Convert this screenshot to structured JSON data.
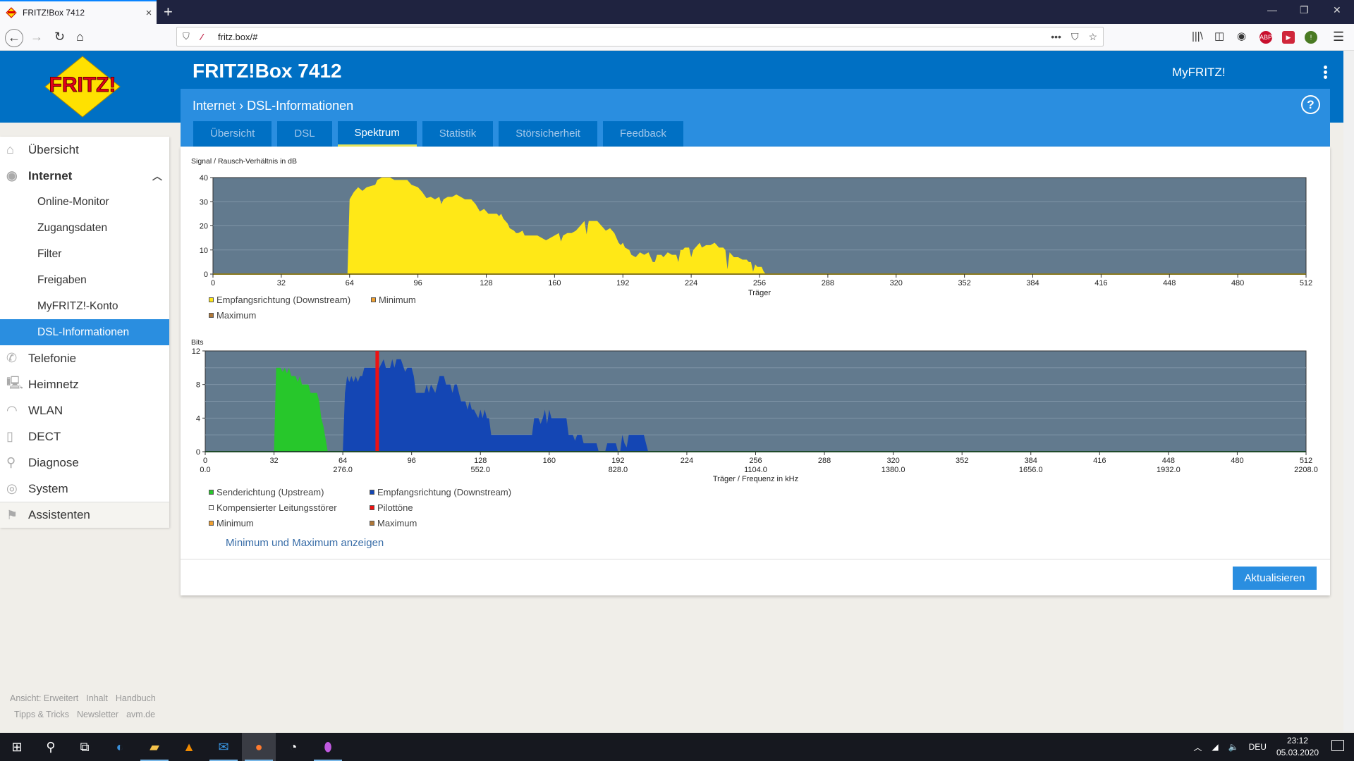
{
  "browser": {
    "tab_title": "FRITZ!Box 7412",
    "url": "fritz.box/#",
    "new_tab_label": "+",
    "close_tab_label": "×"
  },
  "header": {
    "title": "FRITZ!Box 7412",
    "myfritz": "MyFRITZ!",
    "breadcrumb_parent": "Internet",
    "breadcrumb_sep": ">",
    "breadcrumb_current": "DSL-Informationen",
    "help_label": "?",
    "logo_text": "FRITZ!"
  },
  "tabs": [
    {
      "label": "Übersicht",
      "active": false
    },
    {
      "label": "DSL",
      "active": false
    },
    {
      "label": "Spektrum",
      "active": true
    },
    {
      "label": "Statistik",
      "active": false
    },
    {
      "label": "Störsicherheit",
      "active": false
    },
    {
      "label": "Feedback",
      "active": false
    }
  ],
  "sidebar": {
    "items": [
      {
        "label": "Übersicht",
        "icon": "home-icon",
        "glyph": "⌂"
      },
      {
        "label": "Internet",
        "icon": "globe-icon",
        "glyph": "◉",
        "expanded": true
      },
      {
        "label": "Online-Monitor",
        "sub": true
      },
      {
        "label": "Zugangsdaten",
        "sub": true
      },
      {
        "label": "Filter",
        "sub": true
      },
      {
        "label": "Freigaben",
        "sub": true
      },
      {
        "label": "MyFRITZ!-Konto",
        "sub": true
      },
      {
        "label": "DSL-Informationen",
        "sub": true,
        "active": true
      },
      {
        "label": "Telefonie",
        "icon": "phone-icon",
        "glyph": "✆"
      },
      {
        "label": "Heimnetz",
        "icon": "network-icon",
        "glyph": "🖳"
      },
      {
        "label": "WLAN",
        "icon": "wifi-icon",
        "glyph": "◠"
      },
      {
        "label": "DECT",
        "icon": "dect-phone-icon",
        "glyph": "▯"
      },
      {
        "label": "Diagnose",
        "icon": "diagnose-icon",
        "glyph": "⚲"
      },
      {
        "label": "System",
        "icon": "system-icon",
        "glyph": "◎"
      },
      {
        "label": "Assistenten",
        "icon": "assistant-icon",
        "glyph": "⚑"
      }
    ],
    "footer_row1": [
      "Ansicht: Erweitert",
      "Inhalt",
      "Handbuch"
    ],
    "footer_row2": [
      "Tipps & Tricks",
      "Newsletter",
      "avm.de"
    ]
  },
  "content": {
    "show_minmax_link": "Minimum und Maximum anzeigen",
    "refresh_button": "Aktualisieren"
  },
  "colors": {
    "brand_blue": "#0070c4",
    "accent_blue": "#2a8ee0",
    "plot_bg": "#627a8e",
    "snr_yellow": "#ffe817",
    "upstream_green": "#27c72b",
    "downstream_blue": "#1446b4",
    "pilot_red": "#ee1111",
    "minimum_orange": "#f0a030",
    "maximum_brown": "#b07838"
  },
  "chart_data": [
    {
      "type": "area",
      "title": "Signal / Rausch-Verhältnis in dB",
      "xlabel": "Träger",
      "ylabel": "Signal / Rausch-Verhältnis in dB",
      "xlim": [
        0,
        512
      ],
      "ylim": [
        0,
        40
      ],
      "x_ticks": [
        0,
        32,
        64,
        96,
        128,
        160,
        192,
        224,
        256,
        288,
        320,
        352,
        384,
        416,
        448,
        480,
        512
      ],
      "y_ticks": [
        0,
        10,
        20,
        30,
        40
      ],
      "grid": true,
      "legend": [
        {
          "label": "Empfangsrichtung (Downstream)",
          "color": "#ffe817"
        },
        {
          "label": "Minimum",
          "color": "#f0a030"
        },
        {
          "label": "Maximum",
          "color": "#b07838"
        }
      ],
      "series": [
        {
          "name": "Empfangsrichtung (Downstream)",
          "color": "#ffe817",
          "points": [
            [
              63,
              0
            ],
            [
              64,
              31
            ],
            [
              66,
              34
            ],
            [
              68,
              36
            ],
            [
              70,
              34.5
            ],
            [
              72,
              36
            ],
            [
              74,
              36.5
            ],
            [
              76,
              37
            ],
            [
              77,
              39
            ],
            [
              79,
              40
            ],
            [
              83,
              40
            ],
            [
              85,
              39
            ],
            [
              91,
              39
            ],
            [
              93,
              37
            ],
            [
              96,
              36
            ],
            [
              98,
              34
            ],
            [
              100,
              31.5
            ],
            [
              102,
              32
            ],
            [
              104,
              31
            ],
            [
              106,
              32
            ],
            [
              107,
              29
            ],
            [
              108,
              31
            ],
            [
              110,
              32
            ],
            [
              112,
              32
            ],
            [
              114,
              33
            ],
            [
              116,
              32
            ],
            [
              118,
              31
            ],
            [
              121,
              31
            ],
            [
              123,
              29
            ],
            [
              125,
              26
            ],
            [
              127,
              27
            ],
            [
              129,
              25
            ],
            [
              133,
              25
            ],
            [
              134,
              24
            ],
            [
              135,
              25
            ],
            [
              136,
              23
            ],
            [
              138,
              21
            ],
            [
              139,
              19
            ],
            [
              141,
              18
            ],
            [
              142,
              17
            ],
            [
              143,
              17
            ],
            [
              145,
              18
            ],
            [
              146,
              16
            ],
            [
              152,
              16
            ],
            [
              154,
              15
            ],
            [
              156,
              14
            ],
            [
              158,
              15
            ],
            [
              160,
              16
            ],
            [
              162,
              17
            ],
            [
              163,
              13.5
            ],
            [
              164,
              16
            ],
            [
              166,
              17
            ],
            [
              168,
              17
            ],
            [
              170,
              18
            ],
            [
              172,
              20
            ],
            [
              174,
              22
            ],
            [
              175,
              16.5
            ],
            [
              176,
              22
            ],
            [
              180,
              22
            ],
            [
              182,
              20
            ],
            [
              184,
              18
            ],
            [
              186,
              19
            ],
            [
              188,
              17
            ],
            [
              190,
              13
            ],
            [
              191,
              12
            ],
            [
              192,
              13
            ],
            [
              193,
              11
            ],
            [
              195,
              10
            ],
            [
              196,
              8
            ],
            [
              198,
              7
            ],
            [
              200,
              9
            ],
            [
              202,
              8
            ],
            [
              204,
              9
            ],
            [
              205,
              7
            ],
            [
              206,
              5
            ],
            [
              207,
              5
            ],
            [
              208,
              8
            ],
            [
              210,
              8
            ],
            [
              211,
              7
            ],
            [
              213,
              9
            ],
            [
              215,
              8
            ],
            [
              217,
              8
            ],
            [
              218,
              5
            ],
            [
              219,
              10
            ],
            [
              220,
              10
            ],
            [
              221,
              11
            ],
            [
              223,
              11
            ],
            [
              224,
              7
            ],
            [
              225,
              10
            ],
            [
              227,
              12
            ],
            [
              228,
              13
            ],
            [
              229,
              11
            ],
            [
              231,
              12
            ],
            [
              233,
              12
            ],
            [
              235,
              13
            ],
            [
              237,
              11
            ],
            [
              239,
              11
            ],
            [
              240,
              10
            ],
            [
              241,
              2
            ],
            [
              242,
              9
            ],
            [
              244,
              7
            ],
            [
              246,
              7
            ],
            [
              248,
              6
            ],
            [
              250,
              6
            ],
            [
              251,
              5
            ],
            [
              252,
              5
            ],
            [
              253,
              1
            ],
            [
              254,
              4
            ],
            [
              255,
              3
            ],
            [
              257,
              3
            ],
            [
              258,
              1
            ],
            [
              259,
              0
            ]
          ]
        }
      ]
    },
    {
      "type": "area",
      "title": "Bits",
      "xlabel": "Träger / Frequenz in kHz",
      "ylabel": "Bits",
      "xlim": [
        0,
        512
      ],
      "ylim": [
        0,
        12
      ],
      "x_ticks": [
        0,
        32,
        64,
        96,
        128,
        160,
        192,
        224,
        256,
        288,
        320,
        352,
        384,
        416,
        448,
        480,
        512
      ],
      "x_freq_labels": {
        "0": "0.0",
        "64": "276.0",
        "128": "552.0",
        "192": "828.0",
        "256": "1104.0",
        "320": "1380.0",
        "384": "1656.0",
        "448": "1932.0",
        "512": "2208.0"
      },
      "y_ticks": [
        0,
        4,
        8,
        12
      ],
      "grid": true,
      "legend": [
        {
          "label": "Senderichtung (Upstream)",
          "color": "#27c72b"
        },
        {
          "label": "Empfangsrichtung (Downstream)",
          "color": "#1446b4"
        },
        {
          "label": "Kompensierter Leitungsstörer",
          "color": "#ffffff"
        },
        {
          "label": "Pilottöne",
          "color": "#ee1111"
        },
        {
          "label": "Minimum",
          "color": "#f0a030"
        },
        {
          "label": "Maximum",
          "color": "#b07838"
        }
      ],
      "pilot_tones": [
        80
      ],
      "series": [
        {
          "name": "Senderichtung (Upstream)",
          "color": "#27c72b",
          "points": [
            [
              32,
              0
            ],
            [
              33,
              10
            ],
            [
              35,
              10
            ],
            [
              36,
              9.5
            ],
            [
              37,
              10
            ],
            [
              38,
              9.3
            ],
            [
              39,
              10
            ],
            [
              40,
              9
            ],
            [
              42,
              9
            ],
            [
              43,
              8.3
            ],
            [
              44,
              9
            ],
            [
              45,
              8
            ],
            [
              48,
              8
            ],
            [
              49,
              7
            ],
            [
              52,
              7
            ],
            [
              53,
              6
            ],
            [
              54,
              4
            ],
            [
              55,
              3
            ],
            [
              57,
              0
            ]
          ]
        },
        {
          "name": "Empfangsrichtung (Downstream)",
          "color": "#1446b4",
          "points": [
            [
              64,
              0
            ],
            [
              65,
              7
            ],
            [
              66,
              9
            ],
            [
              67,
              8.3
            ],
            [
              68,
              9
            ],
            [
              69,
              8.3
            ],
            [
              70,
              9
            ],
            [
              71,
              8.3
            ],
            [
              72,
              9
            ],
            [
              73,
              9
            ],
            [
              74,
              10
            ],
            [
              78,
              10
            ],
            [
              79,
              10
            ],
            [
              81,
              10
            ],
            [
              83,
              11
            ],
            [
              84,
              10
            ],
            [
              86,
              10
            ],
            [
              87,
              11
            ],
            [
              88,
              10
            ],
            [
              89,
              11
            ],
            [
              91,
              11
            ],
            [
              93,
              9.5
            ],
            [
              94,
              10
            ],
            [
              96,
              10
            ],
            [
              97,
              9
            ],
            [
              98,
              7
            ],
            [
              102,
              7
            ],
            [
              103,
              8
            ],
            [
              104,
              7
            ],
            [
              105,
              8
            ],
            [
              107,
              7
            ],
            [
              109,
              9
            ],
            [
              111,
              9
            ],
            [
              112,
              8
            ],
            [
              114,
              8
            ],
            [
              115,
              7
            ],
            [
              116,
              8
            ],
            [
              117,
              8
            ],
            [
              119,
              6
            ],
            [
              121,
              6
            ],
            [
              122,
              5
            ],
            [
              123,
              6
            ],
            [
              124,
              5
            ],
            [
              125,
              5
            ],
            [
              127,
              4
            ],
            [
              128,
              5
            ],
            [
              129,
              4
            ],
            [
              130,
              5
            ],
            [
              131,
              4
            ],
            [
              132,
              4
            ],
            [
              133,
              2
            ],
            [
              152,
              2
            ],
            [
              153,
              4
            ],
            [
              155,
              4
            ],
            [
              156,
              3.3
            ],
            [
              157,
              4
            ],
            [
              158,
              5
            ],
            [
              159,
              3.3
            ],
            [
              160,
              5
            ],
            [
              161,
              4
            ],
            [
              168,
              4
            ],
            [
              169,
              2
            ],
            [
              171,
              2
            ],
            [
              172,
              1.3
            ],
            [
              173,
              2
            ],
            [
              175,
              2
            ],
            [
              176,
              1
            ],
            [
              182,
              1
            ],
            [
              183,
              0
            ],
            [
              186,
              0
            ],
            [
              187,
              1
            ],
            [
              191,
              1
            ],
            [
              192,
              0
            ],
            [
              193,
              0
            ],
            [
              194,
              2
            ],
            [
              195,
              1
            ],
            [
              196,
              0.5
            ],
            [
              197,
              2
            ],
            [
              204,
              2
            ],
            [
              206,
              0
            ]
          ]
        }
      ]
    }
  ],
  "taskbar": {
    "apps": [
      {
        "name": "start-icon",
        "glyph": "⊞"
      },
      {
        "name": "search-icon",
        "glyph": "⚲"
      },
      {
        "name": "task-view-icon",
        "glyph": "⧉"
      },
      {
        "name": "thunderbird-icon",
        "glyph": "◐"
      },
      {
        "name": "file-explorer-icon",
        "glyph": "▰"
      },
      {
        "name": "vlc-icon",
        "glyph": "▲"
      },
      {
        "name": "mail-icon",
        "glyph": "✉"
      },
      {
        "name": "firefox-icon",
        "glyph": "●"
      },
      {
        "name": "speedtest-icon",
        "glyph": "◔"
      },
      {
        "name": "maps-icon",
        "glyph": "⬮"
      }
    ],
    "language": "DEU",
    "time": "23:12",
    "date": "05.03.2020"
  }
}
